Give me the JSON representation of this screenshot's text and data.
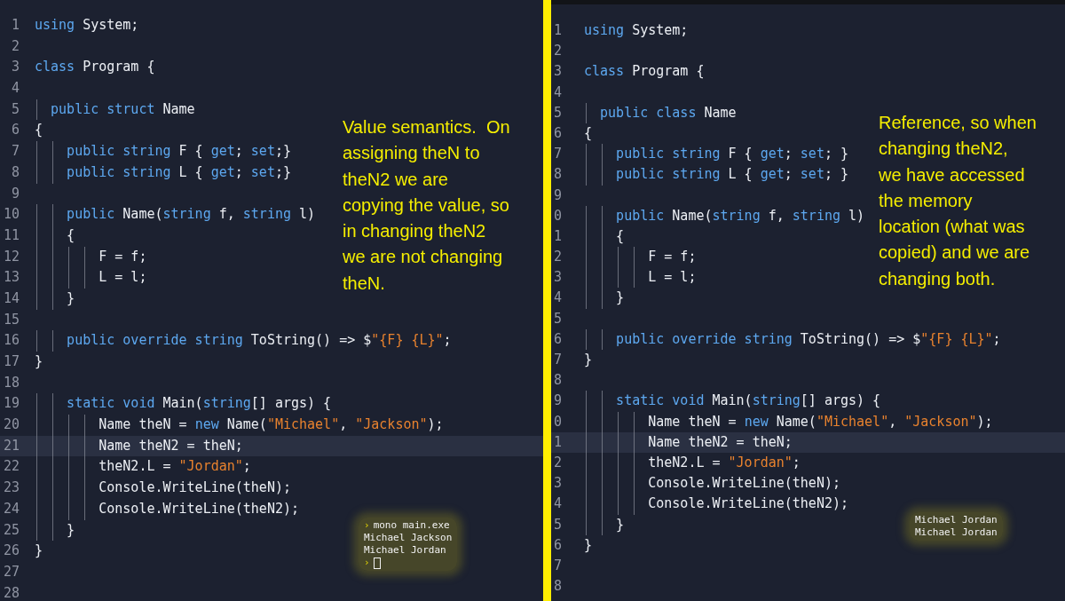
{
  "panels": [
    {
      "note": "Value semantics.  On\nassigning theN to\ntheN2 we are\ncopying the value, so\nin changing theN2\nwe are not changing\ntheN.",
      "lines": [
        {
          "n": "1",
          "selected": false,
          "tokens": [
            {
              "t": "using",
              "kind": "keyword"
            },
            {
              "t": " System;",
              "kind": "plain"
            }
          ]
        },
        {
          "n": "2",
          "selected": false
        },
        {
          "n": "3",
          "selected": false,
          "tokens": [
            {
              "t": "class",
              "kind": "keyword"
            },
            {
              "t": " Program {",
              "kind": "plain"
            }
          ]
        },
        {
          "n": "4",
          "selected": false
        },
        {
          "n": "5",
          "selected": false,
          "tokens": [
            {
              "t": "  public struct",
              "kind": "keyword"
            },
            {
              "t": " Name",
              "kind": "plain"
            }
          ]
        },
        {
          "n": "6",
          "selected": false,
          "tokens": [
            {
              "t": "{",
              "kind": "plain"
            }
          ]
        },
        {
          "n": "7",
          "selected": false,
          "tokens": [
            {
              "t": "    public string",
              "kind": "keyword"
            },
            {
              "t": " F { ",
              "kind": "plain"
            },
            {
              "t": "get",
              "kind": "keyword"
            },
            {
              "t": "; ",
              "kind": "plain"
            },
            {
              "t": "set",
              "kind": "keyword"
            },
            {
              "t": ";}",
              "kind": "plain"
            }
          ]
        },
        {
          "n": "8",
          "selected": false,
          "tokens": [
            {
              "t": "    public string",
              "kind": "keyword"
            },
            {
              "t": " L { ",
              "kind": "plain"
            },
            {
              "t": "get",
              "kind": "keyword"
            },
            {
              "t": "; ",
              "kind": "plain"
            },
            {
              "t": "set",
              "kind": "keyword"
            },
            {
              "t": ";}",
              "kind": "plain"
            }
          ]
        },
        {
          "n": "9",
          "selected": false
        },
        {
          "n": "10",
          "selected": false,
          "tokens": [
            {
              "t": "    public",
              "kind": "keyword"
            },
            {
              "t": " Name(",
              "kind": "plain"
            },
            {
              "t": "string",
              "kind": "keyword"
            },
            {
              "t": " f, ",
              "kind": "plain"
            },
            {
              "t": "string",
              "kind": "keyword"
            },
            {
              "t": " l)",
              "kind": "plain"
            }
          ]
        },
        {
          "n": "11",
          "selected": false,
          "tokens": [
            {
              "t": "    {",
              "kind": "plain"
            }
          ]
        },
        {
          "n": "12",
          "selected": false,
          "tokens": [
            {
              "t": "        F = f;",
              "kind": "plain"
            }
          ]
        },
        {
          "n": "13",
          "selected": false,
          "tokens": [
            {
              "t": "        L = l;",
              "kind": "plain"
            }
          ]
        },
        {
          "n": "14",
          "selected": false,
          "tokens": [
            {
              "t": "    }",
              "kind": "plain"
            }
          ]
        },
        {
          "n": "15",
          "selected": false
        },
        {
          "n": "16",
          "selected": false,
          "tokens": [
            {
              "t": "    public override string",
              "kind": "keyword"
            },
            {
              "t": " ToString() => $",
              "kind": "plain"
            },
            {
              "t": "\"{F} {L}\"",
              "kind": "string"
            },
            {
              "t": ";",
              "kind": "plain"
            }
          ]
        },
        {
          "n": "17",
          "selected": false,
          "tokens": [
            {
              "t": "}",
              "kind": "plain"
            }
          ]
        },
        {
          "n": "18",
          "selected": false
        },
        {
          "n": "19",
          "selected": false,
          "tokens": [
            {
              "t": "    static void",
              "kind": "keyword"
            },
            {
              "t": " Main(",
              "kind": "plain"
            },
            {
              "t": "string",
              "kind": "keyword"
            },
            {
              "t": "[] args) {",
              "kind": "plain"
            }
          ]
        },
        {
          "n": "20",
          "selected": false,
          "tokens": [
            {
              "t": "        Name theN = ",
              "kind": "plain"
            },
            {
              "t": "new",
              "kind": "keyword"
            },
            {
              "t": " Name(",
              "kind": "plain"
            },
            {
              "t": "\"Michael\"",
              "kind": "string"
            },
            {
              "t": ", ",
              "kind": "plain"
            },
            {
              "t": "\"Jackson\"",
              "kind": "string"
            },
            {
              "t": ");",
              "kind": "plain"
            }
          ]
        },
        {
          "n": "21",
          "selected": true,
          "tokens": [
            {
              "t": "        Name theN2 = theN;",
              "kind": "plain"
            }
          ]
        },
        {
          "n": "22",
          "selected": false,
          "tokens": [
            {
              "t": "        theN2.L = ",
              "kind": "plain"
            },
            {
              "t": "\"Jordan\"",
              "kind": "string"
            },
            {
              "t": ";",
              "kind": "plain"
            }
          ]
        },
        {
          "n": "23",
          "selected": false,
          "tokens": [
            {
              "t": "        Console.WriteLine(theN);",
              "kind": "plain"
            }
          ]
        },
        {
          "n": "24",
          "selected": false,
          "tokens": [
            {
              "t": "        Console.WriteLine(theN2);",
              "kind": "plain"
            }
          ]
        },
        {
          "n": "25",
          "selected": false,
          "tokens": [
            {
              "t": "    }",
              "kind": "plain"
            }
          ]
        },
        {
          "n": "26",
          "selected": false,
          "tokens": [
            {
              "t": "}",
              "kind": "plain"
            }
          ]
        },
        {
          "n": "27",
          "selected": false
        },
        {
          "n": "28",
          "selected": false
        }
      ],
      "terminal": [
        {
          "prompt": "›",
          "text": "mono main.exe"
        },
        {
          "text": "Michael Jackson"
        },
        {
          "text": "Michael Jordan"
        },
        {
          "prompt": "›",
          "cursor": true
        }
      ]
    },
    {
      "note": "Reference, so when\nchanging theN2,\nwe have accessed\nthe memory\nlocation (what was\ncopied) and we are\nchanging both.",
      "lines": [
        {
          "n": "1",
          "selected": false,
          "tokens": [
            {
              "t": "using",
              "kind": "keyword"
            },
            {
              "t": " System;",
              "kind": "plain"
            }
          ]
        },
        {
          "n": "2",
          "selected": false
        },
        {
          "n": "3",
          "selected": false,
          "tokens": [
            {
              "t": "class",
              "kind": "keyword"
            },
            {
              "t": " Program {",
              "kind": "plain"
            }
          ]
        },
        {
          "n": "4",
          "selected": false
        },
        {
          "n": "5",
          "selected": false,
          "tokens": [
            {
              "t": "  public class",
              "kind": "keyword"
            },
            {
              "t": " Name",
              "kind": "plain"
            }
          ]
        },
        {
          "n": "6",
          "selected": false,
          "tokens": [
            {
              "t": "{",
              "kind": "plain"
            }
          ]
        },
        {
          "n": "7",
          "selected": false,
          "tokens": [
            {
              "t": "    public string",
              "kind": "keyword"
            },
            {
              "t": " F { ",
              "kind": "plain"
            },
            {
              "t": "get",
              "kind": "keyword"
            },
            {
              "t": "; ",
              "kind": "plain"
            },
            {
              "t": "set",
              "kind": "keyword"
            },
            {
              "t": "; }",
              "kind": "plain"
            }
          ]
        },
        {
          "n": "8",
          "selected": false,
          "tokens": [
            {
              "t": "    public string",
              "kind": "keyword"
            },
            {
              "t": " L { ",
              "kind": "plain"
            },
            {
              "t": "get",
              "kind": "keyword"
            },
            {
              "t": "; ",
              "kind": "plain"
            },
            {
              "t": "set",
              "kind": "keyword"
            },
            {
              "t": "; }",
              "kind": "plain"
            }
          ]
        },
        {
          "n": "9",
          "selected": false
        },
        {
          "n": "0",
          "selected": false,
          "tokens": [
            {
              "t": "    public",
              "kind": "keyword"
            },
            {
              "t": " Name(",
              "kind": "plain"
            },
            {
              "t": "string",
              "kind": "keyword"
            },
            {
              "t": " f, ",
              "kind": "plain"
            },
            {
              "t": "string",
              "kind": "keyword"
            },
            {
              "t": " l)",
              "kind": "plain"
            }
          ]
        },
        {
          "n": "1",
          "selected": false,
          "tokens": [
            {
              "t": "    {",
              "kind": "plain"
            }
          ]
        },
        {
          "n": "2",
          "selected": false,
          "tokens": [
            {
              "t": "        F = f;",
              "kind": "plain"
            }
          ]
        },
        {
          "n": "3",
          "selected": false,
          "tokens": [
            {
              "t": "        L = l;",
              "kind": "plain"
            }
          ]
        },
        {
          "n": "4",
          "selected": false,
          "tokens": [
            {
              "t": "    }",
              "kind": "plain"
            }
          ]
        },
        {
          "n": "5",
          "selected": false
        },
        {
          "n": "6",
          "selected": false,
          "tokens": [
            {
              "t": "    public override string",
              "kind": "keyword"
            },
            {
              "t": " ToString() => $",
              "kind": "plain"
            },
            {
              "t": "\"{F} {L}\"",
              "kind": "string"
            },
            {
              "t": ";",
              "kind": "plain"
            }
          ]
        },
        {
          "n": "7",
          "selected": false,
          "tokens": [
            {
              "t": "}",
              "kind": "plain"
            }
          ]
        },
        {
          "n": "8",
          "selected": false
        },
        {
          "n": "9",
          "selected": false,
          "tokens": [
            {
              "t": "    static void",
              "kind": "keyword"
            },
            {
              "t": " Main(",
              "kind": "plain"
            },
            {
              "t": "string",
              "kind": "keyword"
            },
            {
              "t": "[] args) {",
              "kind": "plain"
            }
          ]
        },
        {
          "n": "0",
          "selected": false,
          "tokens": [
            {
              "t": "        Name theN = ",
              "kind": "plain"
            },
            {
              "t": "new",
              "kind": "keyword"
            },
            {
              "t": " Name(",
              "kind": "plain"
            },
            {
              "t": "\"Michael\"",
              "kind": "string"
            },
            {
              "t": ", ",
              "kind": "plain"
            },
            {
              "t": "\"Jackson\"",
              "kind": "string"
            },
            {
              "t": ");",
              "kind": "plain"
            }
          ]
        },
        {
          "n": "1",
          "selected": true,
          "tokens": [
            {
              "t": "        Name theN2 = theN;",
              "kind": "plain"
            }
          ]
        },
        {
          "n": "2",
          "selected": false,
          "tokens": [
            {
              "t": "        theN2.L = ",
              "kind": "plain"
            },
            {
              "t": "\"Jordan\"",
              "kind": "string"
            },
            {
              "t": ";",
              "kind": "plain"
            }
          ]
        },
        {
          "n": "3",
          "selected": false,
          "tokens": [
            {
              "t": "        Console.WriteLine(theN);",
              "kind": "plain"
            }
          ]
        },
        {
          "n": "4",
          "selected": false,
          "tokens": [
            {
              "t": "        Console.WriteLine(theN2);",
              "kind": "plain"
            }
          ]
        },
        {
          "n": "5",
          "selected": false,
          "tokens": [
            {
              "t": "    }",
              "kind": "plain"
            }
          ]
        },
        {
          "n": "6",
          "selected": false,
          "tokens": [
            {
              "t": "}",
              "kind": "plain"
            }
          ]
        },
        {
          "n": "7",
          "selected": false
        },
        {
          "n": "8",
          "selected": false
        }
      ],
      "terminal": [
        {
          "text": "Michael Jordan"
        },
        {
          "text": "Michael Jordan"
        }
      ]
    }
  ]
}
